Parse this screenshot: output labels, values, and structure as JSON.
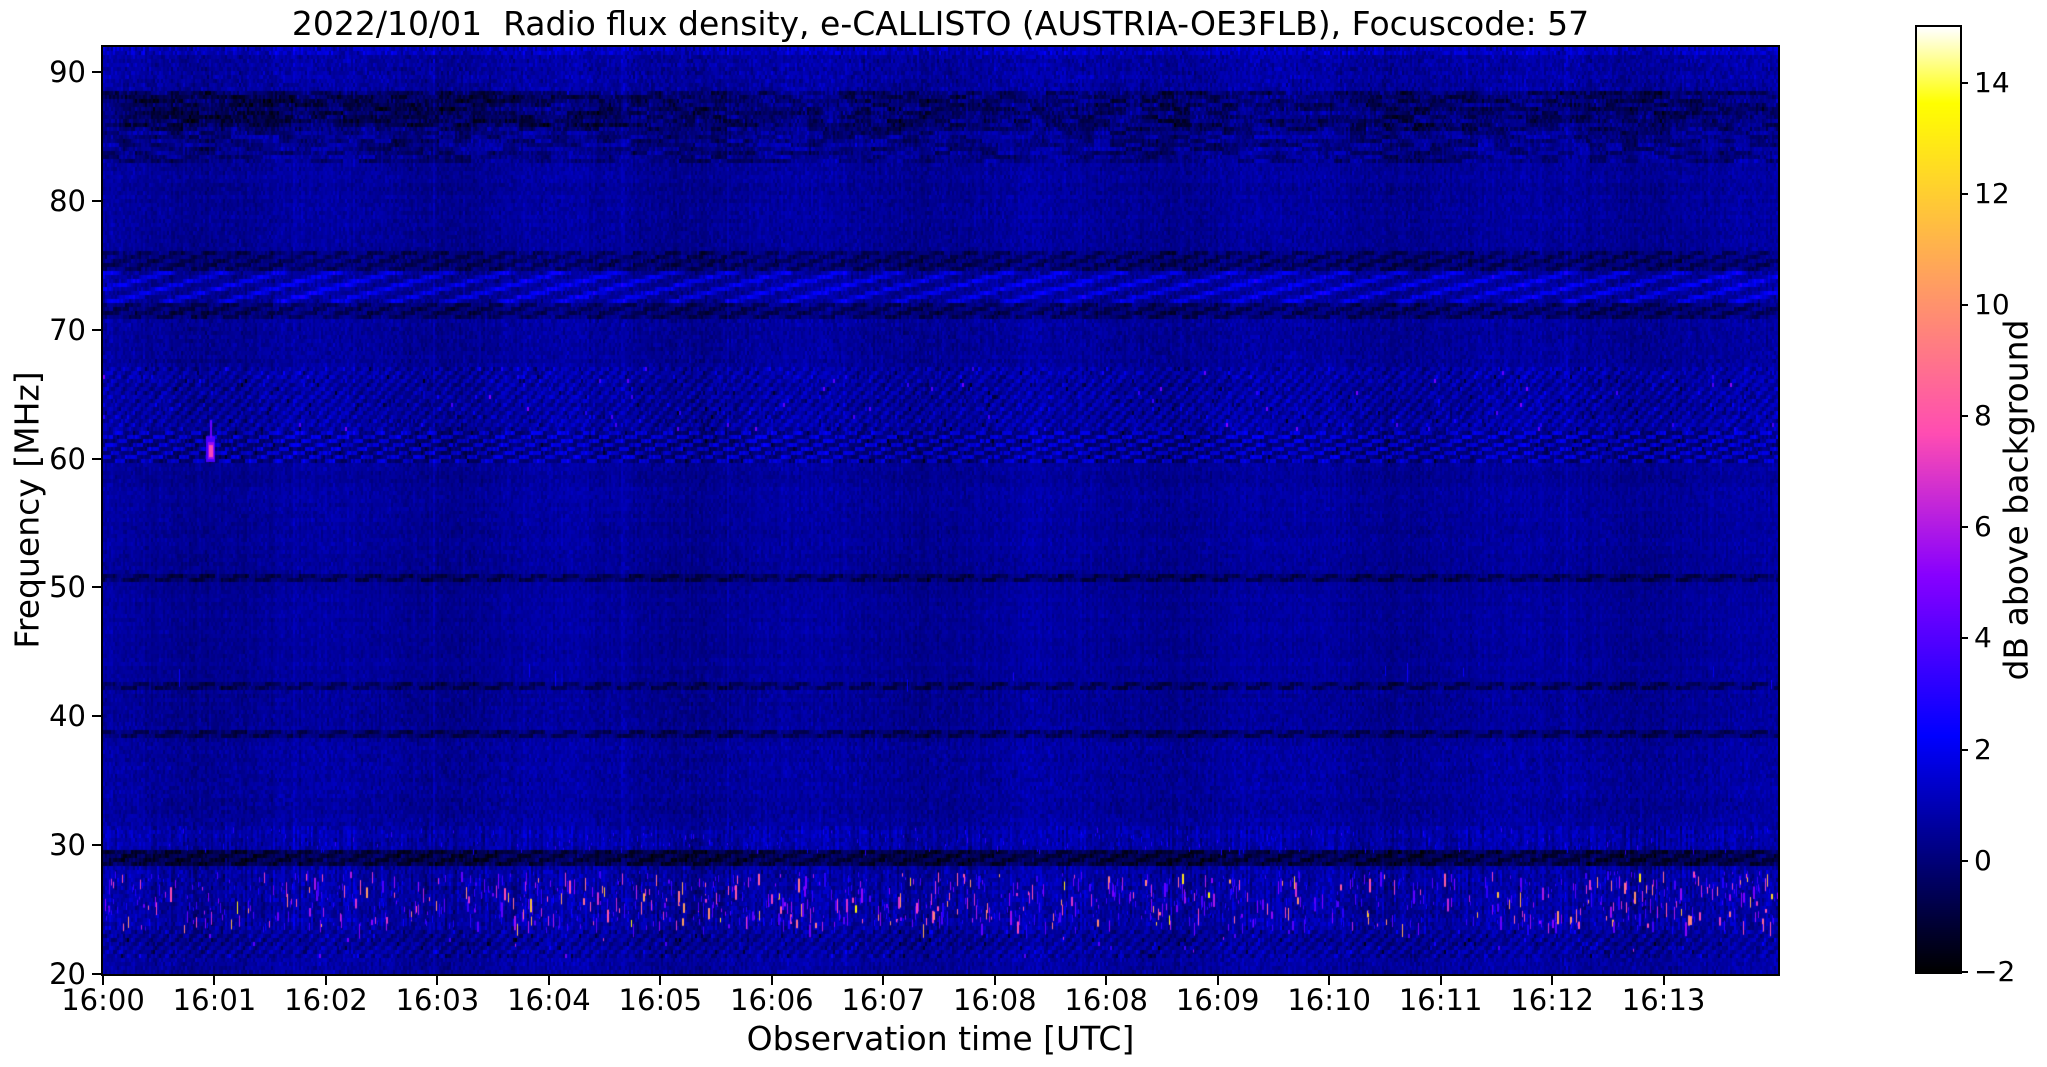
{
  "figure": {
    "background_color": "#ffffff",
    "text_color": "#000000"
  },
  "chart_data": {
    "type": "heatmap",
    "title": "2022/10/01  Radio flux density, e-CALLISTO (AUSTRIA-OE3FLB), Focuscode: 57",
    "xlabel": "Observation time [UTC]",
    "ylabel": "Frequency [MHz]",
    "colorbar_label": "dB above background",
    "x_tick_labels": [
      "16:00",
      "16:01",
      "16:02",
      "16:03",
      "16:04",
      "16:05",
      "16:06",
      "16:07",
      "16:08",
      "16:08",
      "16:09",
      "16:10",
      "16:11",
      "16:12",
      "16:13"
    ],
    "y_tick_values": [
      90,
      80,
      70,
      60,
      50,
      40,
      30,
      20
    ],
    "colorbar_tick_values": [
      14,
      12,
      10,
      8,
      6,
      4,
      2,
      0,
      -2
    ],
    "colorbar_tick_labels": [
      "14",
      "12",
      "10",
      "8",
      "6",
      "4",
      "2",
      "0",
      "−2"
    ],
    "value_range_db": [
      -2,
      15
    ],
    "freq_axis_range_mhz": [
      20,
      91.9
    ],
    "time_axis_start_utc": "16:00",
    "time_axis_span_minutes": 15,
    "colormap": "gnuplot2",
    "grid": false,
    "legend": "none",
    "background_level_db": 0.55,
    "features": {
      "bands": [
        {
          "f_hi": 91.9,
          "f_lo": 91.2,
          "mean_db": 1.1,
          "sigma_db": 0.9,
          "pattern": "noise",
          "note": "bright speckled top edge"
        },
        {
          "f_hi": 91.2,
          "f_lo": 88.6,
          "mean_db": 0.7,
          "sigma_db": 0.65,
          "pattern": "noise"
        },
        {
          "f_hi": 88.6,
          "f_lo": 85.4,
          "mean_db": 0.0,
          "sigma_db": 0.75,
          "pattern": "blocky-dark",
          "note": "dark RFI band, darkest 16:00-16:04"
        },
        {
          "f_hi": 85.4,
          "f_lo": 83.0,
          "mean_db": 0.35,
          "sigma_db": 0.6,
          "pattern": "blocky-dark"
        },
        {
          "f_hi": 83.0,
          "f_lo": 76.0,
          "mean_db": 0.55,
          "sigma_db": 0.45,
          "pattern": "noise"
        },
        {
          "f_hi": 76.0,
          "f_lo": 74.6,
          "mean_db": 0.25,
          "sigma_db": 0.5,
          "pattern": "dark-dashes"
        },
        {
          "f_hi": 74.6,
          "f_lo": 72.2,
          "mean_db": 0.8,
          "sigma_db": 0.6,
          "pattern": "bright-dashes",
          "note": "periodic bright blue dashes ~73 MHz"
        },
        {
          "f_hi": 72.2,
          "f_lo": 70.8,
          "mean_db": 0.2,
          "sigma_db": 0.5,
          "pattern": "dark-dashes"
        },
        {
          "f_hi": 70.8,
          "f_lo": 67.0,
          "mean_db": 0.55,
          "sigma_db": 0.5,
          "pattern": "noise"
        },
        {
          "f_hi": 67.0,
          "f_lo": 62.2,
          "mean_db": 0.65,
          "sigma_db": 0.55,
          "pattern": "herringbone",
          "note": "diagonal weave texture 62-67 MHz"
        },
        {
          "f_hi": 62.2,
          "f_lo": 59.8,
          "mean_db": 0.45,
          "sigma_db": 0.6,
          "pattern": "bright-dark-dashes"
        },
        {
          "f_hi": 59.8,
          "f_lo": 51.0,
          "mean_db": 0.55,
          "sigma_db": 0.4,
          "pattern": "noise"
        },
        {
          "f_hi": 51.0,
          "f_lo": 50.3,
          "mean_db": 0.1,
          "sigma_db": 0.45,
          "pattern": "dark-dashes",
          "note": "thin dark dashed line ~50.5 MHz"
        },
        {
          "f_hi": 50.3,
          "f_lo": 42.6,
          "mean_db": 0.55,
          "sigma_db": 0.35,
          "pattern": "noise"
        },
        {
          "f_hi": 42.6,
          "f_lo": 41.9,
          "mean_db": 0.15,
          "sigma_db": 0.45,
          "pattern": "dark-dashes"
        },
        {
          "f_hi": 41.9,
          "f_lo": 38.9,
          "mean_db": 0.5,
          "sigma_db": 0.45,
          "pattern": "noise"
        },
        {
          "f_hi": 38.9,
          "f_lo": 38.3,
          "mean_db": 0.1,
          "sigma_db": 0.45,
          "pattern": "dark-dashes"
        },
        {
          "f_hi": 38.3,
          "f_lo": 31.5,
          "mean_db": 0.6,
          "sigma_db": 0.5,
          "pattern": "noise"
        },
        {
          "f_hi": 31.5,
          "f_lo": 29.4,
          "mean_db": 0.85,
          "sigma_db": 0.6,
          "pattern": "speckle-bg"
        },
        {
          "f_hi": 29.4,
          "f_lo": 28.2,
          "mean_db": -0.35,
          "sigma_db": 0.55,
          "pattern": "dark-dashes",
          "note": "dark gap band ~28.8 MHz"
        },
        {
          "f_hi": 28.2,
          "f_lo": 23.2,
          "mean_db": 0.7,
          "sigma_db": 0.7,
          "pattern": "speckle-bg",
          "note": "HF RFI band with many bright bursts"
        },
        {
          "f_hi": 23.2,
          "f_lo": 21.2,
          "mean_db": 0.55,
          "sigma_db": 0.5,
          "pattern": "herringbone"
        },
        {
          "f_hi": 21.2,
          "f_lo": 20.0,
          "mean_db": 0.65,
          "sigma_db": 0.55,
          "pattern": "noise"
        }
      ],
      "rfi_speckle_band": {
        "f_hi": 28.0,
        "f_lo": 23.3,
        "streak_db_range": [
          2.8,
          13.5
        ],
        "density_base": 0.33,
        "dense_time_fraction": [
          0.23,
          0.68
        ],
        "density_dense": 0.55,
        "right_edge_fraction": 0.88,
        "density_right": 0.6
      },
      "point_source": {
        "time_utc": "16:01",
        "freq_mhz": 60.5,
        "peak_db": 7.5,
        "note": "small magenta burst left of 16:01"
      }
    }
  }
}
